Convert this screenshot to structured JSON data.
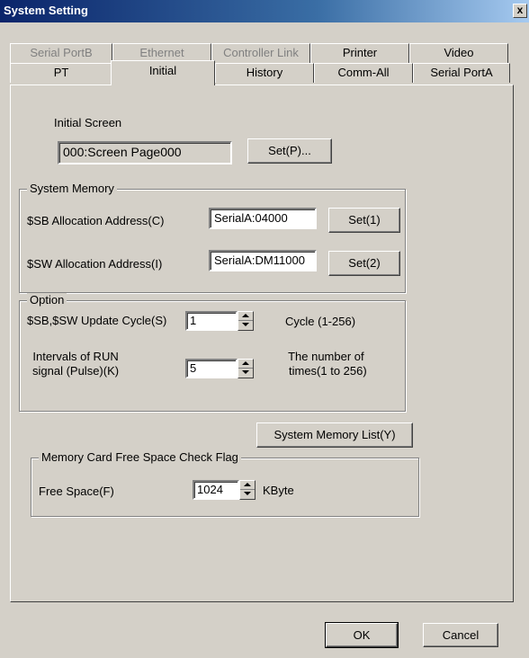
{
  "window": {
    "title": "System Setting",
    "close_label": "x"
  },
  "tabs": {
    "back_row": [
      "Serial PortB",
      "Ethernet",
      "Controller Link",
      "Printer",
      "Video"
    ],
    "front_row": [
      "PT",
      "Initial",
      "History",
      "Comm-All",
      "Serial PortA"
    ],
    "active": "Initial"
  },
  "initial_screen": {
    "label": "Initial Screen",
    "value": "000:Screen Page000",
    "set_button": "Set(P)..."
  },
  "system_memory": {
    "legend": "System Memory",
    "sb_label": "$SB Allocation Address(C)",
    "sb_value": "SerialA:04000",
    "sb_button": "Set(1)",
    "sw_label": "$SW Allocation Address(I)",
    "sw_value": "SerialA:DM11000",
    "sw_button": "Set(2)"
  },
  "option": {
    "legend": "Option",
    "update_label": "$SB,$SW Update Cycle(S)",
    "update_value": "1",
    "update_unit": "Cycle (1-256)",
    "run_label_line1": "Intervals of RUN",
    "run_label_line2": "signal (Pulse)(K)",
    "run_value": "5",
    "run_unit_line1": "The number of",
    "run_unit_line2": "times(1 to 256)"
  },
  "memory_list_button": "System Memory List(Y)",
  "memory_card": {
    "legend": "Memory Card Free Space Check Flag",
    "free_label": "Free Space(F)",
    "free_value": "1024",
    "free_unit": "KByte"
  },
  "footer": {
    "ok": "OK",
    "cancel": "Cancel"
  },
  "colors": {
    "face": "#d4d0c8",
    "title_start": "#0a246a",
    "title_end": "#a6caf0"
  }
}
